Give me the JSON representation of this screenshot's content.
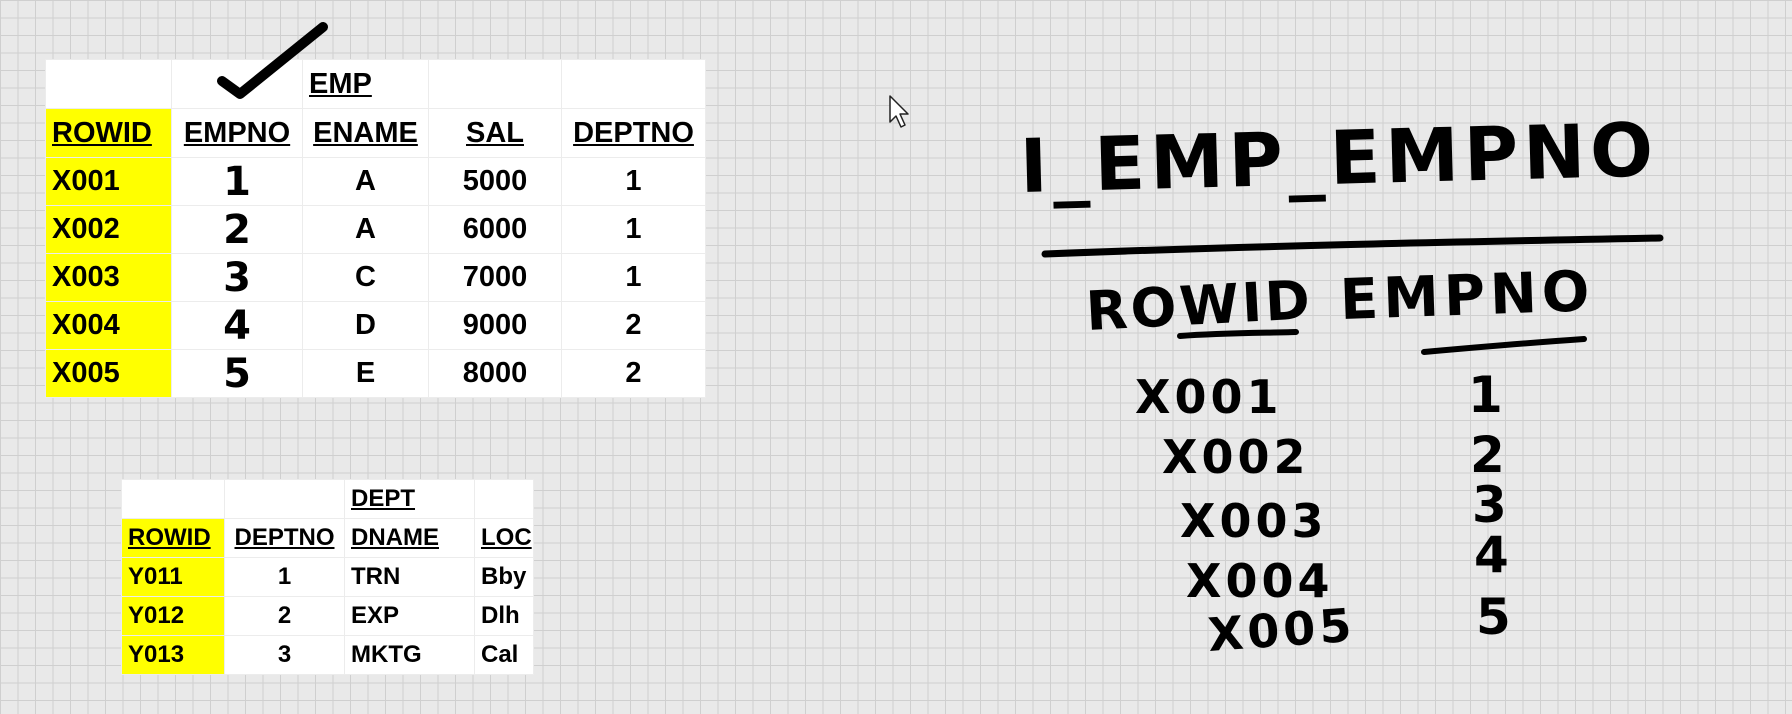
{
  "emp_table": {
    "title": "EMP",
    "columns": [
      "ROWID",
      "EMPNO",
      "ENAME",
      "SAL",
      "DEPTNO"
    ],
    "rows": [
      [
        "X001",
        "1",
        "A",
        "5000",
        "1"
      ],
      [
        "X002",
        "2",
        "A",
        "6000",
        "1"
      ],
      [
        "X003",
        "3",
        "C",
        "7000",
        "1"
      ],
      [
        "X004",
        "4",
        "D",
        "9000",
        "2"
      ],
      [
        "X005",
        "5",
        "E",
        "8000",
        "2"
      ]
    ]
  },
  "dept_table": {
    "title": "DEPT",
    "columns": [
      "ROWID",
      "DEPTNO",
      "DNAME",
      "LOC"
    ],
    "rows": [
      [
        "Y011",
        "1",
        "TRN",
        "Bby"
      ],
      [
        "Y012",
        "2",
        "EXP",
        "Dlh"
      ],
      [
        "Y013",
        "3",
        "MKTG",
        "Cal"
      ]
    ]
  },
  "index_note": {
    "title": "I_EMP_EMPNO",
    "col_rowid": "ROWID",
    "col_empno": "EMPNO",
    "rows": [
      [
        "X001",
        "1"
      ],
      [
        "X002",
        "2"
      ],
      [
        "X003",
        "3"
      ],
      [
        "X004",
        "4"
      ],
      [
        "X005",
        "5"
      ]
    ]
  },
  "colors": {
    "highlight": "#ffff00",
    "grid_background": "#e9e9e9",
    "ink": "#000000"
  },
  "icons": [
    "checkmark-annotation",
    "mouse-pointer-icon"
  ]
}
